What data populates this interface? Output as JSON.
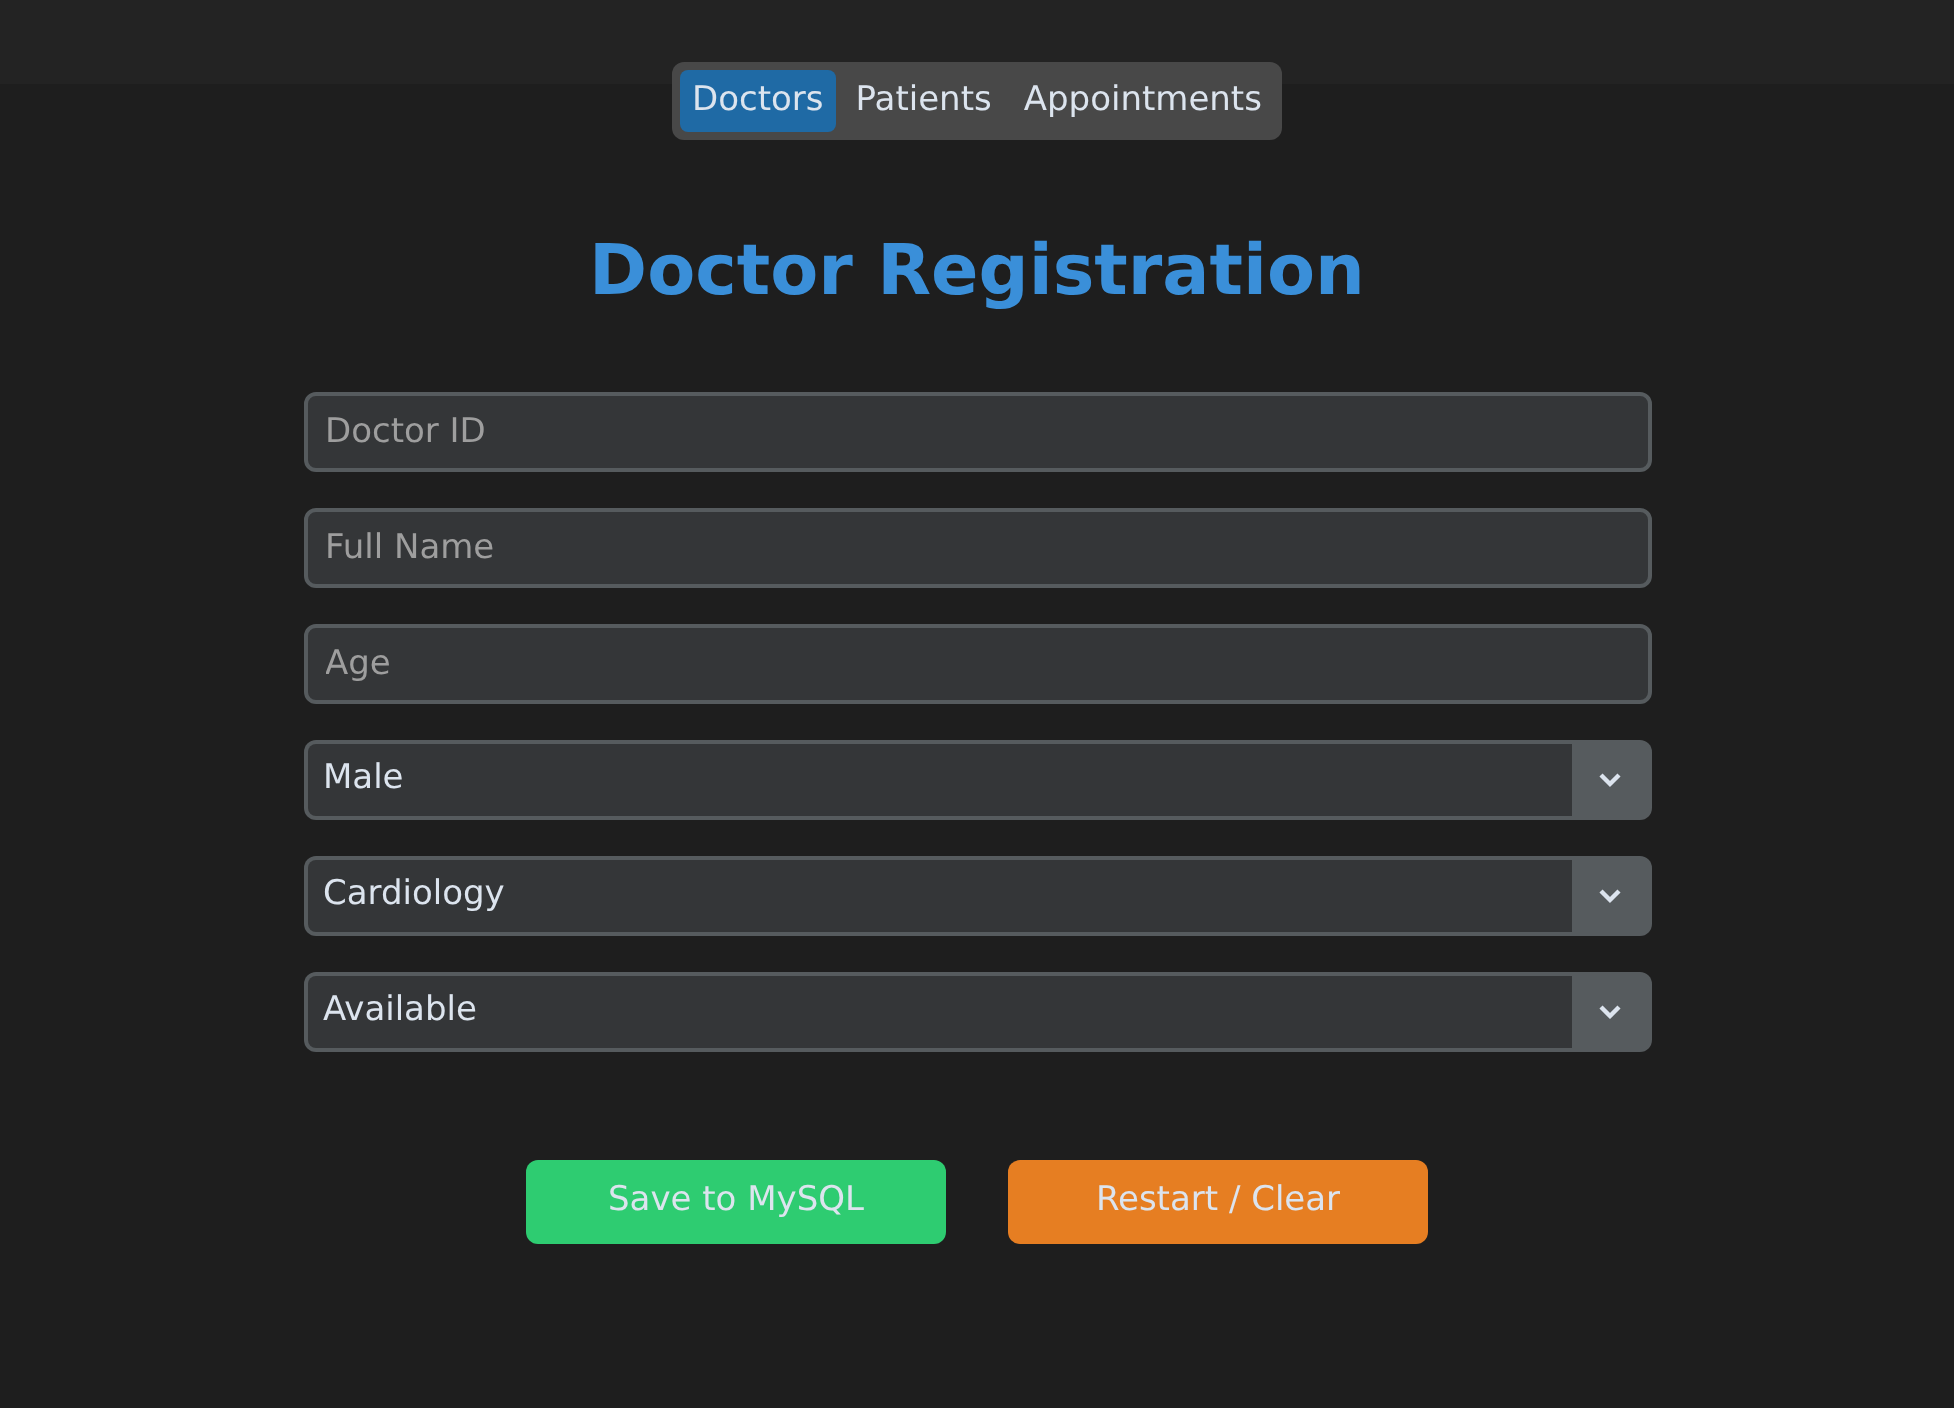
{
  "tabs": [
    {
      "label": "Doctors",
      "selected": true
    },
    {
      "label": "Patients",
      "selected": false
    },
    {
      "label": "Appointments",
      "selected": false
    }
  ],
  "title": "Doctor Registration",
  "fields": [
    {
      "kind": "text",
      "placeholder": "Doctor ID"
    },
    {
      "kind": "text",
      "placeholder": "Full Name"
    },
    {
      "kind": "text",
      "placeholder": "Age"
    },
    {
      "kind": "select",
      "value": "Male"
    },
    {
      "kind": "select",
      "value": "Cardiology"
    },
    {
      "kind": "select",
      "value": "Available"
    }
  ],
  "buttons": [
    {
      "label": "Save to MySQL",
      "color": "#2ecc71"
    },
    {
      "label": "Restart / Clear",
      "color": "#e67e22"
    }
  ]
}
